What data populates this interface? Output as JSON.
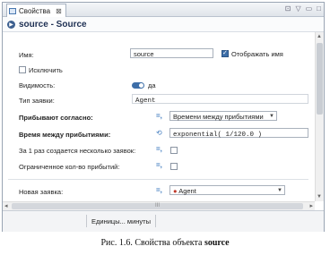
{
  "tab": {
    "label": "Свойства",
    "close": "⊠"
  },
  "header": {
    "title": "source - Source"
  },
  "fields": {
    "name_label": "Имя:",
    "name_value": "source",
    "show_name_label": "Отображать имя",
    "exclude_label": "Исключить",
    "visibility_label": "Видимость:",
    "visibility_value": "да",
    "request_type_label": "Тип заявки:",
    "request_type_value": "Agent",
    "arrive_label": "Прибывают согласно:",
    "arrive_value": "Времени между прибытиями",
    "interarrival_label": "Время между прибытиями:",
    "interarrival_value": "exponential( 1/120.0 )",
    "multi_label": "За 1 раз создается несколько заявок:",
    "limited_label": "Ограниченное кол-во прибытий:",
    "new_request_label": "Новая заявка:",
    "new_request_value": "Agent"
  },
  "status": {
    "units": "Единицы... минуты"
  },
  "scroll": {
    "grip": "III"
  },
  "caption": {
    "prefix": "Рис. 1.6. Свойства объекта ",
    "object": "source"
  }
}
